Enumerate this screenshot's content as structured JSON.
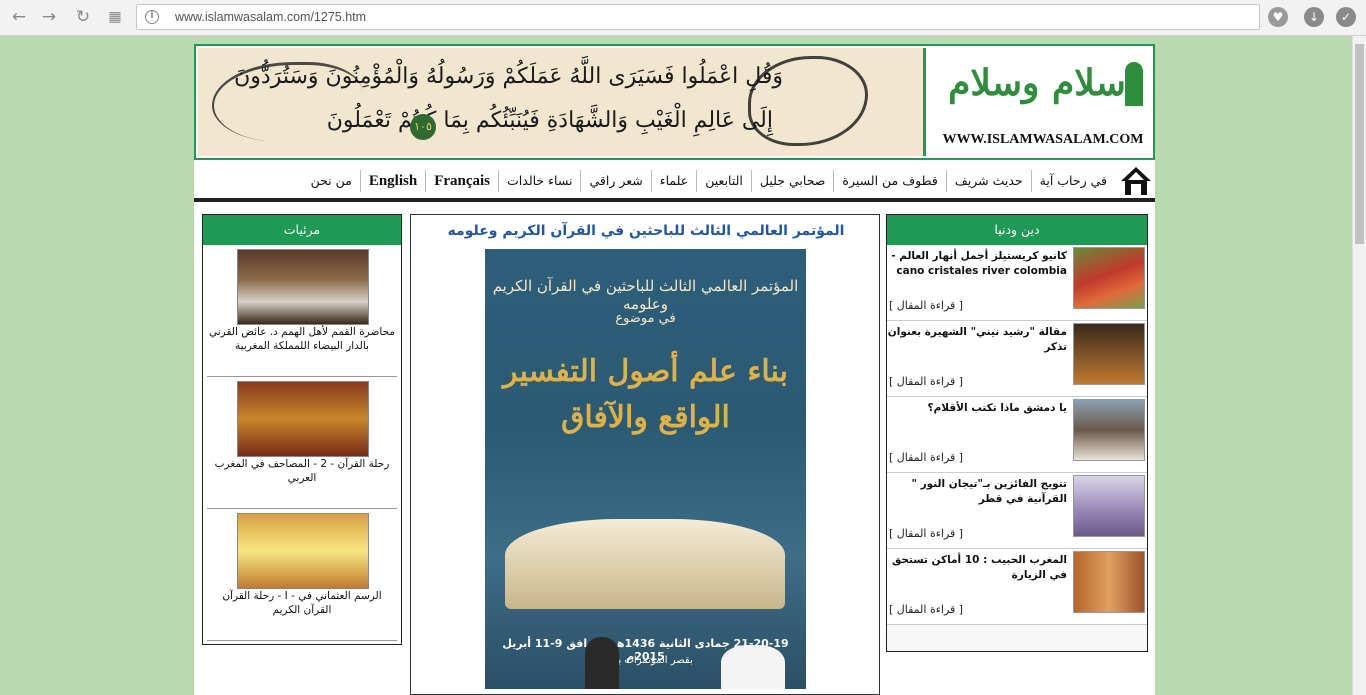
{
  "browser": {
    "url": "www.islamwasalam.com/1275.htm"
  },
  "banner": {
    "verse_line1": "وَقُلِ اعْمَلُوا فَسَيَرَى اللَّهُ عَمَلَكُمْ وَرَسُولُهُ وَالْمُؤْمِنُونَ وَسَتُرَدُّونَ",
    "verse_line2": "إِلَى عَالِمِ الْغَيْبِ وَالشَّهَادَةِ فَيُنَبِّئُكُم بِمَا كُنتُمْ تَعْمَلُونَ",
    "ayah_number": "١٠٥",
    "logo_arabic": "إسلام وسلام",
    "logo_english": "WWW.ISLAMWASALAM.COM"
  },
  "menu": {
    "items": [
      {
        "label": "في رحاب آية"
      },
      {
        "label": "حديث شريف"
      },
      {
        "label": "قطوف من السيرة"
      },
      {
        "label": "صحابي جليل"
      },
      {
        "label": "التابعين"
      },
      {
        "label": "علماء"
      },
      {
        "label": "شعر راقي"
      },
      {
        "label": "نساء خالدات"
      },
      {
        "label": "Français"
      },
      {
        "label": "English"
      },
      {
        "label": "من نحن"
      }
    ]
  },
  "right_column": {
    "header": "دين ودنيا",
    "read_more_label": "[ قراءة المقال ]",
    "items": [
      {
        "title": "كانيو كريستيلز أجمل أنهار العالم - cano cristales river colombia"
      },
      {
        "title": "مقالة \"رشيد نيني\" الشهيرة بعنوان تذكر"
      },
      {
        "title": "يا دمشق ماذا تكتب الأقلام؟"
      },
      {
        "title": "تتويج الفائزين بـ\"تيجان النور \" القرآنية في قطر"
      },
      {
        "title": "المغرب الحبيب : 10 أماكن تستحق في الزيارة"
      }
    ]
  },
  "center_column": {
    "title": "المؤتمر العالمي الثالث للباحثين في القرآن الكريم وعلومه",
    "poster": {
      "line1": "المؤتمر العالمي الثالث للباحثين في القرآن الكريم وعلومه",
      "line2": "في موضوع",
      "headline1": "بناء علم أصول التفسير",
      "headline2": "الواقع والآفاق",
      "date": "21-20-19 جمادى الثانية 1436هـ الموافق 9-11 أبريل 2015م",
      "place": "بقصر المؤتمرات بفاس"
    }
  },
  "left_column": {
    "header": "مرئيات",
    "items": [
      {
        "title": "محاضرة القمم لأهل الهمم د. عائض القرني بالدار البيضاء اللمملكة المغربية"
      },
      {
        "title": "رحلة القرآن - 2 - المصاحف في المغرب العربي"
      },
      {
        "title": "الرسم العثماني في - I - رحلة القرآن القرآن الكريم"
      }
    ]
  },
  "colors": {
    "accent_green": "#1f9a55",
    "title_blue": "#2255aa",
    "page_background": "#b9d9b0"
  }
}
